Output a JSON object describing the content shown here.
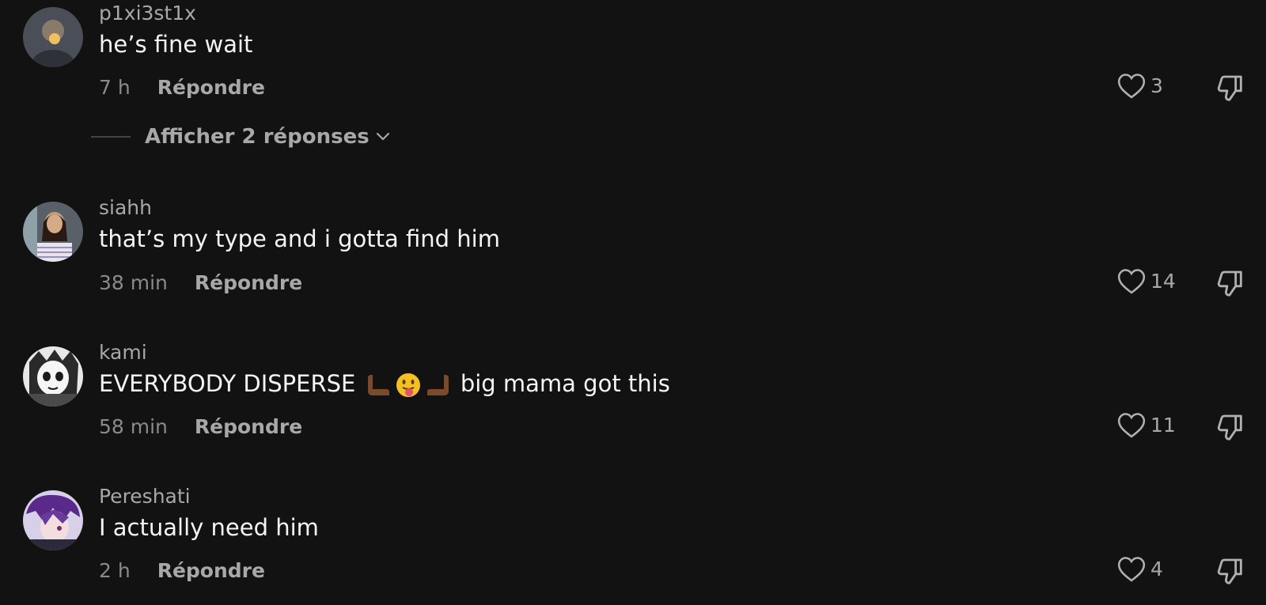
{
  "comments": [
    {
      "username": "p1xi3st1x",
      "text": "he’s fine wait",
      "time": "7 h",
      "reply_label": "Répondre",
      "likes": "3",
      "avatar_icon": "user-avatar-icon"
    },
    {
      "username": "siahh",
      "text": "that’s my type and i gotta find him",
      "time": "38 min",
      "reply_label": "Répondre",
      "likes": "14",
      "avatar_icon": "user-avatar-icon"
    },
    {
      "username": "kami",
      "text_before": "EVERYBODY DISPERSE",
      "text_after": "big mama got this",
      "emojis": [
        "hand-emoji",
        "tongue-face-emoji",
        "hand-emoji"
      ],
      "time": "58 min",
      "reply_label": "Répondre",
      "likes": "11",
      "avatar_icon": "user-avatar-icon"
    },
    {
      "username": "Pereshati",
      "text": "I actually need him",
      "time": "2 h",
      "reply_label": "Répondre",
      "likes": "4",
      "avatar_icon": "user-avatar-icon"
    }
  ],
  "view_replies": {
    "label": "Afficher 2 réponses",
    "icon": "chevron-down-icon"
  },
  "colors": {
    "background": "#121212",
    "text": "#f5f5f5",
    "muted": "#a8a8a8"
  }
}
